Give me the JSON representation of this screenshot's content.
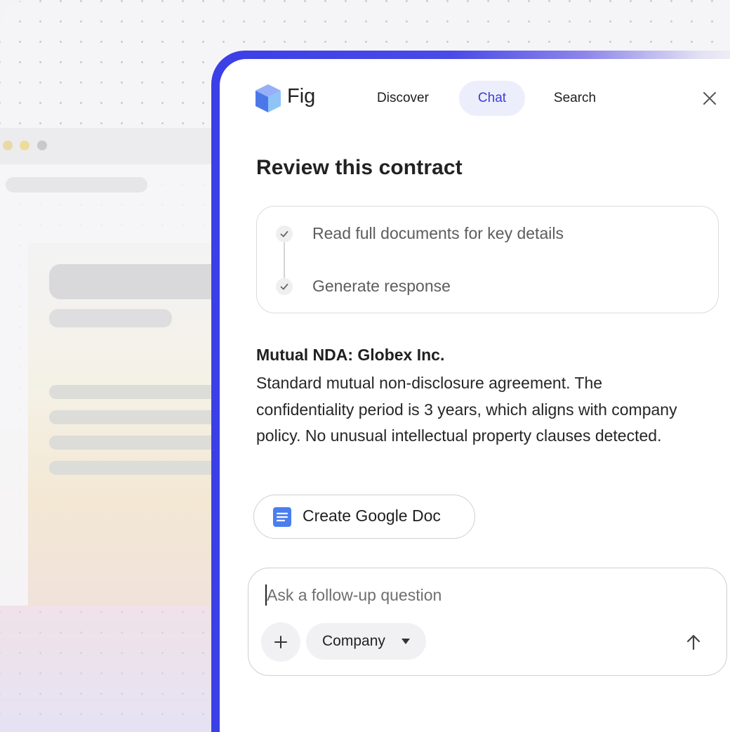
{
  "app": {
    "name": "Fig"
  },
  "nav": {
    "tabs": [
      {
        "label": "Discover",
        "active": false
      },
      {
        "label": "Chat",
        "active": true
      },
      {
        "label": "Search",
        "active": false
      }
    ]
  },
  "header": {
    "close_icon": "close-icon"
  },
  "page": {
    "title": "Review this contract"
  },
  "steps": [
    {
      "label": "Read full documents for key details",
      "status": "done"
    },
    {
      "label": "Generate response",
      "status": "done"
    }
  ],
  "response": {
    "title": "Mutual NDA: Globex Inc.",
    "body": "Standard mutual non-disclosure agreement. The confidentiality period is 3 years, which aligns with company policy. No unusual intellectual property clauses detected."
  },
  "actions": {
    "create_doc_label": "Create Google Doc",
    "create_doc_icon": "google-docs-icon"
  },
  "composer": {
    "placeholder": "Ask a follow-up question",
    "value": "",
    "scope_label": "Company",
    "add_icon": "plus-icon",
    "send_icon": "arrow-up-icon"
  },
  "colors": {
    "accent": "#3a3ddb",
    "active_tab_bg": "#eceefb",
    "border_gradient_start": "#3b3fe6",
    "doc_icon": "#4a7ef0"
  }
}
